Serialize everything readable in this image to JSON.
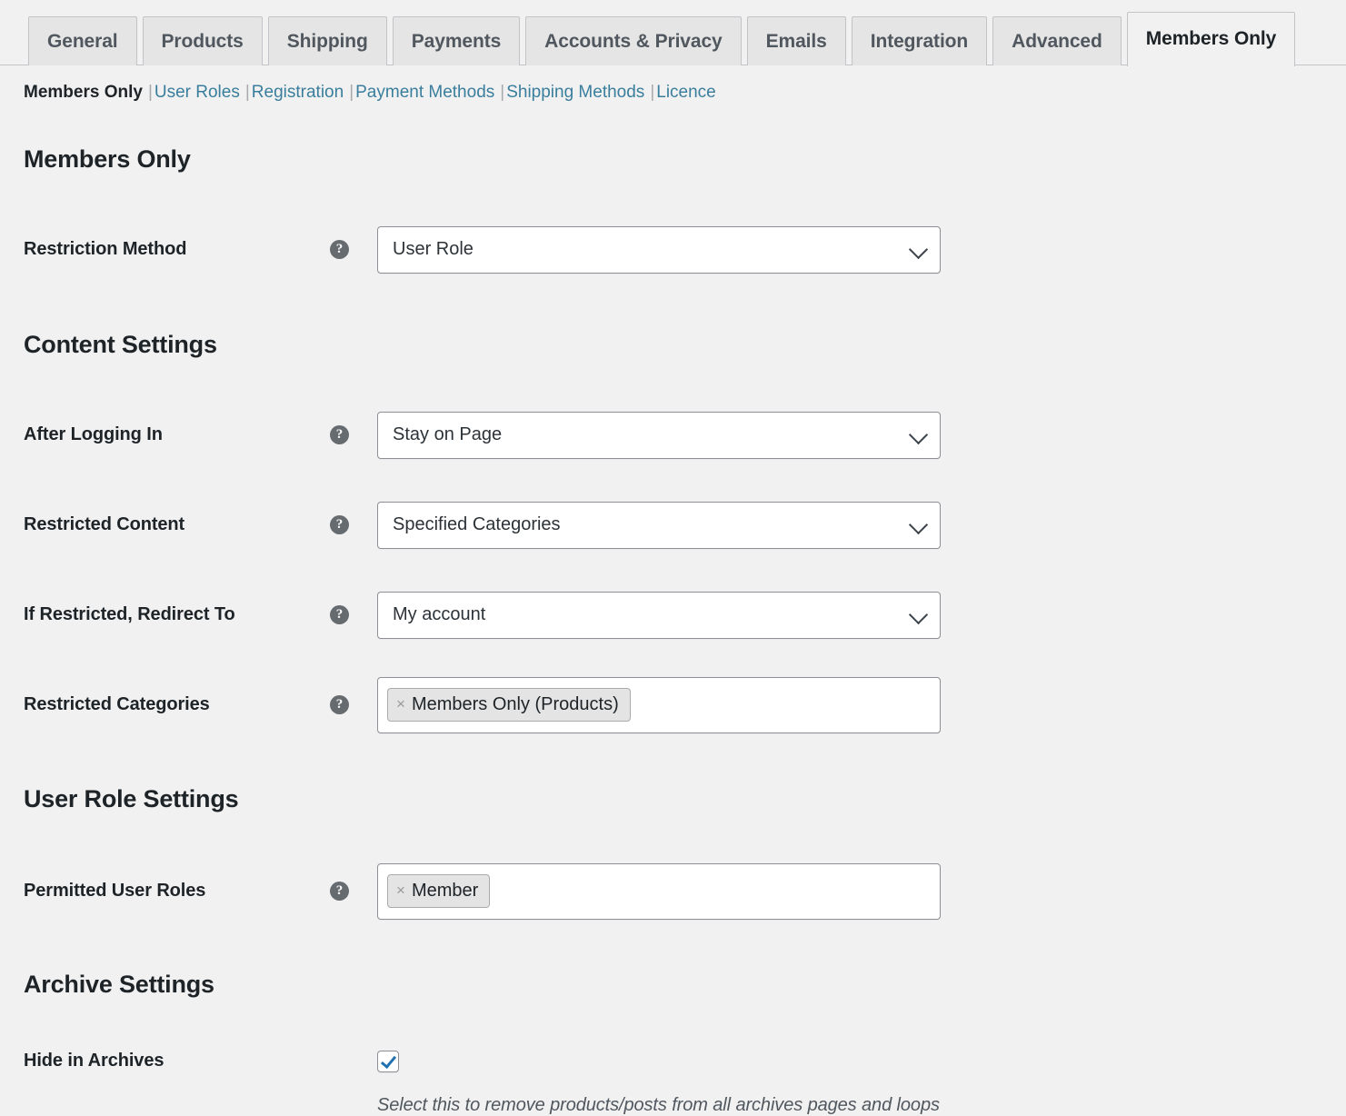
{
  "tabs": [
    {
      "label": "General",
      "active": false
    },
    {
      "label": "Products",
      "active": false
    },
    {
      "label": "Shipping",
      "active": false
    },
    {
      "label": "Payments",
      "active": false
    },
    {
      "label": "Accounts & Privacy",
      "active": false
    },
    {
      "label": "Emails",
      "active": false
    },
    {
      "label": "Integration",
      "active": false
    },
    {
      "label": "Advanced",
      "active": false
    },
    {
      "label": "Members Only",
      "active": true
    }
  ],
  "subnav": {
    "current": "Members Only",
    "links": [
      "User Roles",
      "Registration",
      "Payment Methods",
      "Shipping Methods",
      "Licence"
    ],
    "separator": "|"
  },
  "sections": {
    "members_only": {
      "title": "Members Only",
      "restriction_method": {
        "label": "Restriction Method",
        "value": "User Role",
        "help": "?"
      }
    },
    "content_settings": {
      "title": "Content Settings",
      "after_logging_in": {
        "label": "After Logging In",
        "value": "Stay on Page",
        "help": "?"
      },
      "restricted_content": {
        "label": "Restricted Content",
        "value": "Specified Categories",
        "help": "?"
      },
      "redirect_to": {
        "label": "If Restricted, Redirect To",
        "value": "My account",
        "help": "?"
      },
      "restricted_categories": {
        "label": "Restricted Categories",
        "help": "?",
        "tokens": [
          "Members Only (Products)"
        ],
        "remove_glyph": "×"
      }
    },
    "user_role_settings": {
      "title": "User Role Settings",
      "permitted_user_roles": {
        "label": "Permitted User Roles",
        "help": "?",
        "tokens": [
          "Member"
        ],
        "remove_glyph": "×"
      }
    },
    "archive_settings": {
      "title": "Archive Settings",
      "hide_in_archives": {
        "label": "Hide in Archives",
        "checked": true,
        "hint": "Select this to remove products/posts from all archives pages and loops"
      }
    }
  },
  "colors": {
    "page_background": "#f1f1f1",
    "link": "#3a7e9d",
    "text": "#1d2327",
    "border": "#8c8f94",
    "checkbox_check": "#2271b1",
    "tab_inactive_bg": "#e5e5e5"
  }
}
